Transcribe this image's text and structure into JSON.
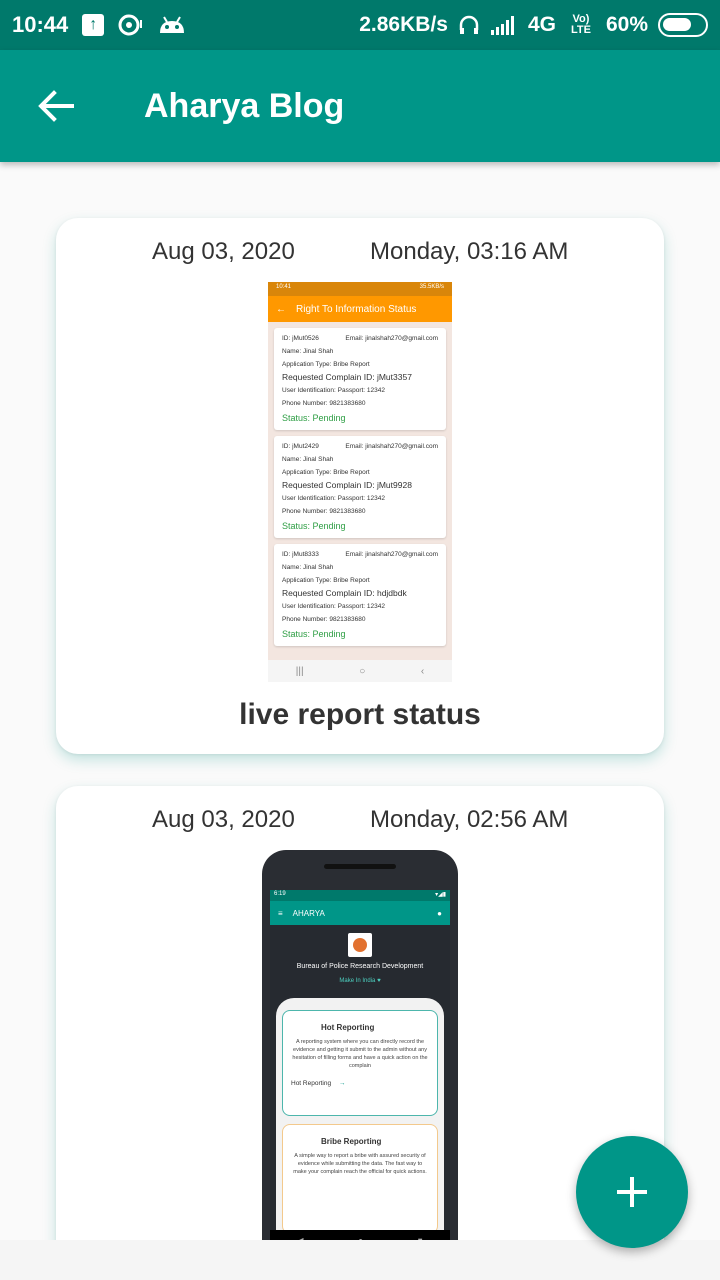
{
  "status_bar": {
    "time": "10:44",
    "speed": "2.86KB/s",
    "network": "4G",
    "volte": "Vo) LTE",
    "battery": "60%"
  },
  "app_bar": {
    "title": "Aharya Blog"
  },
  "posts": [
    {
      "date": "Aug 03, 2020",
      "time": "Monday, 03:16 AM",
      "caption": "live report status",
      "screenshot": {
        "status_time": "10:41",
        "status_right": "35.5KB/s",
        "title": "Right To Information Status",
        "records": [
          {
            "id": "ID: jMut0526",
            "email": "Email: jinalshah270@gmail.com",
            "name": "Name: Jinal Shah",
            "app_type": "Application Type: Bribe Report",
            "complain_id": "Requested Complain ID: jMut3357",
            "user_id": "User Identification: Passport: 12342",
            "phone": "Phone Number: 9821383680",
            "status": "Status: Pending"
          },
          {
            "id": "ID: jMut2429",
            "email": "Email: jinalshah270@gmail.com",
            "name": "Name: Jinal Shah",
            "app_type": "Application Type: Bribe Report",
            "complain_id": "Requested Complain ID: jMut9928",
            "user_id": "User Identification: Passport: 12342",
            "phone": "Phone Number: 9821383680",
            "status": "Status: Pending"
          },
          {
            "id": "ID: jMut8333",
            "email": "Email: jinalshah270@gmail.com",
            "name": "Name: Jinal Shah",
            "app_type": "Application Type: Bribe Report",
            "complain_id": "Requested Complain ID: hdjdbdk",
            "user_id": "User Identification: Passport: 12342",
            "phone": "Phone Number: 9821383680",
            "status": "Status: Pending"
          }
        ]
      }
    },
    {
      "date": "Aug 03, 2020",
      "time": "Monday, 02:56 AM",
      "screenshot": {
        "status_time": "6:19",
        "app_name": "AHARYA",
        "org": "Bureau of Police Research Development",
        "make_in_india": "Make In India",
        "hot_title": "Hot Reporting",
        "hot_body": "A reporting system where you can directly record the evidence and getting it submit to the admin without any hesitation of filling forms and have a quick action on the complain",
        "hot_link": "Hot Reporting",
        "bribe_title": "Bribe Reporting",
        "bribe_body": "A simple way to report a bribe with assured security of evidence while submitting the data. The fast way to make your complain reach the official for quick actions."
      }
    }
  ],
  "icons": {
    "back": "arrow-left-icon",
    "fab": "plus-icon"
  },
  "colors": {
    "status_bar": "#00796b",
    "app_bar": "#009688",
    "fab": "#009688",
    "pending": "#2e9e44"
  }
}
